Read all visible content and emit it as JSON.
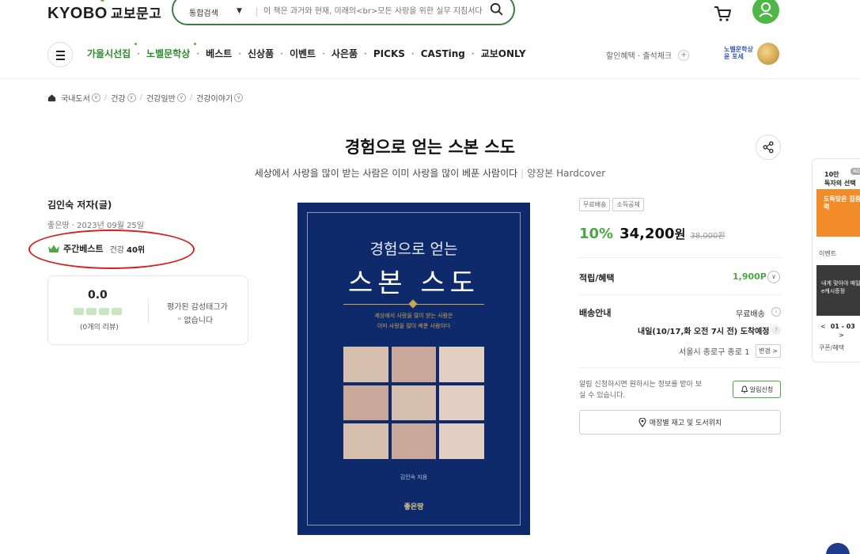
{
  "header": {
    "logo_en": "KYOBO",
    "logo_kr": "교보문고",
    "search_category": "통합검색",
    "search_placeholder": "이 책은 과거와 현재, 미래의<br>모든 사랑을 위한 실무 지침서다"
  },
  "nav": {
    "items": [
      {
        "label": "가을시선집"
      },
      {
        "label": "노벨문학상"
      },
      {
        "label": "베스트"
      },
      {
        "label": "신상품"
      },
      {
        "label": "이벤트"
      },
      {
        "label": "사은품"
      },
      {
        "label": "PICKS"
      },
      {
        "label": "CASTing"
      },
      {
        "label": "교보ONLY"
      }
    ],
    "right_text": "할인혜택 · 출석체크",
    "nobel_line1": "노벨문학상",
    "nobel_line2": "윤 포세"
  },
  "breadcrumb": [
    "국내도서",
    "건강",
    "건강일반",
    "건강이야기"
  ],
  "product": {
    "title": "경험으로 얻는 스본 스도",
    "subtitle": "세상에서 사랑을 많이 받는 사람은 이미 사랑을 많이 베푼 사람이다",
    "edition": "양장본 Hardcover",
    "author": "김인숙 저자(글)",
    "publisher_date": "좋은땅 · 2023년 09월 25일",
    "best_label": "주간베스트",
    "best_category": "건강",
    "best_rank": "40위"
  },
  "review": {
    "score": "0.0",
    "count": "(0개의 리뷰)",
    "tag_line1": "평가된 감성태그가",
    "tag_line2": "없습니다"
  },
  "cover": {
    "line1": "경험으로 얻는",
    "line2": "스본 스도",
    "desc1": "세상에서 사랑을 많이 받는 사람은",
    "desc2": "이미 사랑을 많이 베푼 사람이다",
    "author": "김인숙 지음",
    "publisher": "좋은땅"
  },
  "purchase": {
    "badges": [
      "무료배송",
      "소득공제"
    ],
    "discount": "10%",
    "price": "34,200",
    "won": "원",
    "original_price": "38,000원",
    "points_label": "적립/혜택",
    "points_value": "1,900P",
    "shipping_label": "배송안내",
    "shipping_value": "무료배송",
    "arrival": "내일(10/17,화 오전 7시 전) 도착예정",
    "address": "서울시 종로구 종로 1",
    "change_label": "변경 >",
    "notice": "알림 신청하시면 원하시는 정보를 받아 보실 수 있습니다.",
    "alert_label": "알림신청",
    "store_label": "매장별 재고 및 도서위치"
  },
  "sidebar": {
    "ad_line1": "10만",
    "ad_line2": "독자의 선택",
    "ad_tag": "AD",
    "ad_img_text": "도둑맞은 집중력",
    "event_label": "이벤트",
    "event_img_text": "내게 맞아야 매일 e캐시증정",
    "pager_prev": "<",
    "pager": "01 - 03",
    "pager_next": ">",
    "coupon_label": "쿠폰/혜택"
  },
  "colors": {
    "brand_green": "#4aa842",
    "cover_navy": "#0f2a6b",
    "highlight_red": "#d62020"
  }
}
